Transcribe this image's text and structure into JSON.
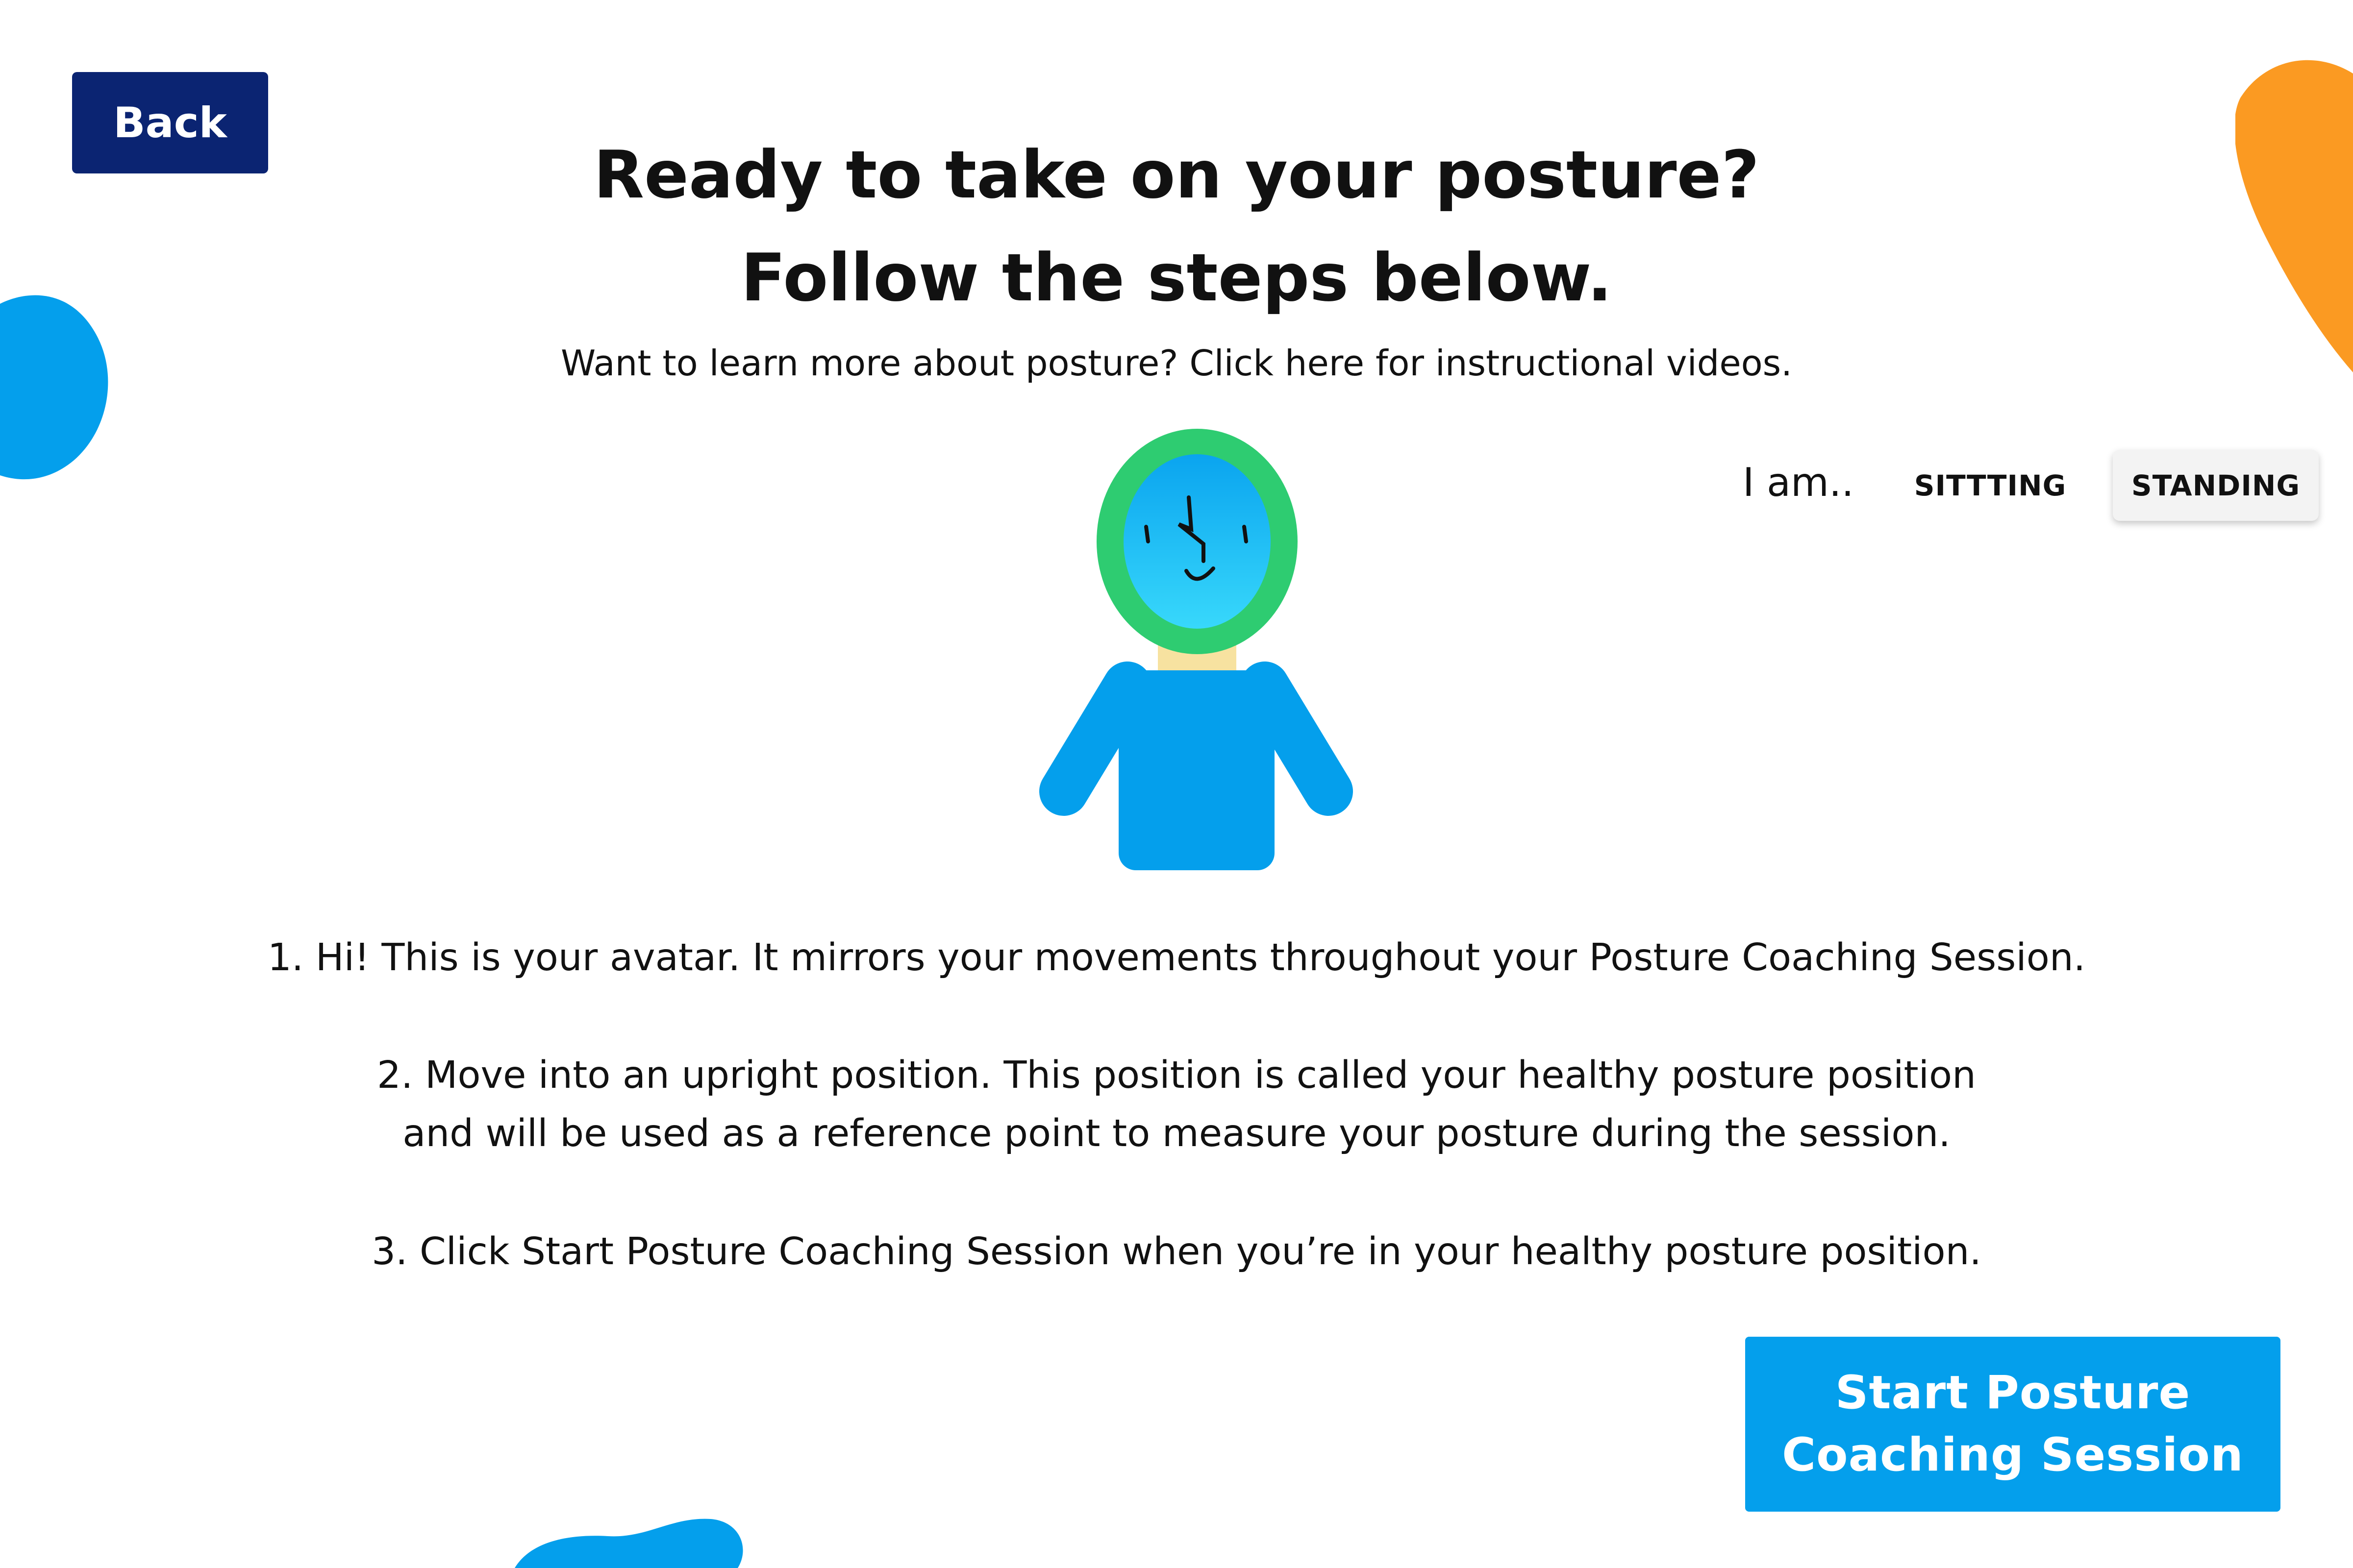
{
  "header": {
    "back_label": "Back",
    "title_line_1": "Ready to take on your posture?",
    "title_line_2": "Follow the steps below.",
    "learn_more": "Want to learn more about posture? Click here for instructional videos."
  },
  "mode_selector": {
    "label": "I am..",
    "options": [
      "SITTTING",
      "STANDING"
    ],
    "selected": "STANDING"
  },
  "steps": [
    "1. Hi! This is your avatar. It mirrors your movements throughout your Posture Coaching Session.",
    "2. Move into an upright position. This position is called your healthy posture position",
    "and will be used as a reference point to measure your posture during the session.",
    "3. Click Start Posture Coaching Session when you’re in your healthy posture position."
  ],
  "start_button": {
    "line_1": "Start Posture",
    "line_2": "Coaching Session"
  },
  "colors": {
    "navy": "#0b2472",
    "blue": "#049fec",
    "orange": "#fb9a22",
    "avatar_ring": "#2ecc71",
    "avatar_face": "#21c3f5",
    "avatar_neck": "#f7e2a0"
  },
  "icons": {
    "avatar": "avatar-figure-icon"
  }
}
